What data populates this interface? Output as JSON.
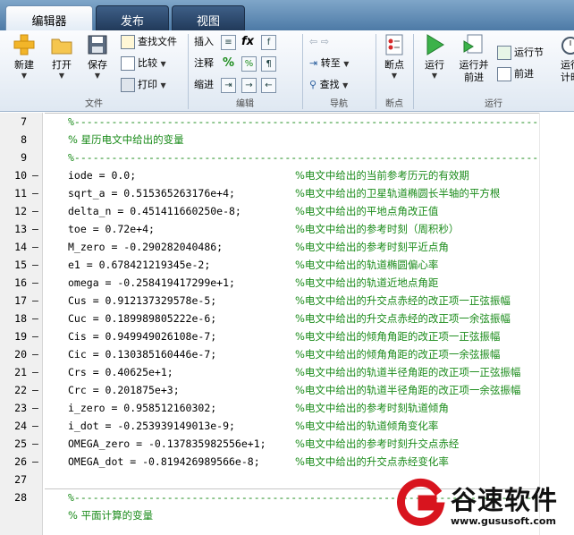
{
  "tabs": [
    {
      "label": "编辑器"
    },
    {
      "label": "发布"
    },
    {
      "label": "视图"
    }
  ],
  "ribbon": {
    "file": {
      "new_label": "新建",
      "open_label": "打开",
      "save_label": "保存",
      "find_files_label": "查找文件",
      "compare_label": "比较",
      "print_label": "打印",
      "group_label": "文件"
    },
    "edit": {
      "insert_label": "插入",
      "comment_label": "注释",
      "indent_label": "缩进",
      "fx_label": "fx",
      "percent_label": "%",
      "group_label": "编辑"
    },
    "navigate": {
      "goto_label": "转至",
      "find_label": "查找",
      "group_label": "导航"
    },
    "breakpoints": {
      "breakpoint_label": "断点",
      "group_label": "断点"
    },
    "run": {
      "run_label": "运行",
      "run_advance_label_1": "运行并",
      "run_advance_label_2": "前进",
      "run_section_label": "运行节",
      "advance_label": "前进",
      "run_time_label_1": "运行",
      "run_time_label_2": "计时",
      "group_label": "运行"
    }
  },
  "editor": {
    "lines": [
      {
        "num": "7",
        "dash": "",
        "type": "full",
        "text": "%---------------------------------------------------------------------------"
      },
      {
        "num": "8",
        "dash": "",
        "type": "fullcjk",
        "text": "% 星历电文中给出的变量"
      },
      {
        "num": "9",
        "dash": "",
        "type": "full",
        "text": "%---------------------------------------------------------------------------"
      },
      {
        "num": "10",
        "dash": "–",
        "type": "code",
        "code": "iode = 0.0;",
        "comment": "%电文中给出的当前参考历元的有效期"
      },
      {
        "num": "11",
        "dash": "–",
        "type": "code",
        "code": "sqrt_a = 0.515365263176e+4;",
        "comment": "%电文中给出的卫星轨道椭圆长半轴的平方根"
      },
      {
        "num": "12",
        "dash": "–",
        "type": "code",
        "code": "delta_n = 0.451411660250e-8;",
        "comment": "%电文中给出的平地点角改正值"
      },
      {
        "num": "13",
        "dash": "–",
        "type": "code",
        "code": "toe = 0.72e+4;",
        "comment": "%电文中给出的参考时刻（周积秒）"
      },
      {
        "num": "14",
        "dash": "–",
        "type": "code",
        "code": "M_zero = -0.290282040486;",
        "comment": "%电文中给出的参考时刻平近点角"
      },
      {
        "num": "15",
        "dash": "–",
        "type": "code",
        "code": "e1 = 0.678421219345e-2;",
        "comment": "%电文中给出的轨道椭圆偏心率"
      },
      {
        "num": "16",
        "dash": "–",
        "type": "code",
        "code": "omega = -0.258419417299e+1;",
        "comment": "%电文中给出的轨道近地点角距"
      },
      {
        "num": "17",
        "dash": "–",
        "type": "code",
        "code": "Cus = 0.912137329578e-5;",
        "comment": "%电文中给出的升交点赤经的改正项一正弦振幅"
      },
      {
        "num": "18",
        "dash": "–",
        "type": "code",
        "code": "Cuc = 0.189989805222e-6;",
        "comment": "%电文中给出的升交点赤经的改正项一余弦振幅"
      },
      {
        "num": "19",
        "dash": "–",
        "type": "code",
        "code": "Cis = 0.949949026108e-7;",
        "comment": "%电文中给出的倾角角距的改正项一正弦振幅"
      },
      {
        "num": "20",
        "dash": "–",
        "type": "code",
        "code": "Cic = 0.130385160446e-7;",
        "comment": "%电文中给出的倾角角距的改正项一余弦振幅"
      },
      {
        "num": "21",
        "dash": "–",
        "type": "code",
        "code": "Crs = 0.40625e+1;",
        "comment": "%电文中给出的轨道半径角距的改正项一正弦振幅"
      },
      {
        "num": "22",
        "dash": "–",
        "type": "code",
        "code": "Crc = 0.201875e+3;",
        "comment": "%电文中给出的轨道半径角距的改正项一余弦振幅"
      },
      {
        "num": "23",
        "dash": "–",
        "type": "code",
        "code": "i_zero = 0.958512160302;",
        "comment": "%电文中给出的参考时刻轨道倾角"
      },
      {
        "num": "24",
        "dash": "–",
        "type": "code",
        "code": "i_dot = -0.253939149013e-9;",
        "comment": "%电文中给出的轨道倾角变化率"
      },
      {
        "num": "25",
        "dash": "–",
        "type": "code",
        "code": "OMEGA_zero = -0.137835982556e+1;",
        "comment": "%电文中给出的参考时刻升交点赤经"
      },
      {
        "num": "26",
        "dash": "–",
        "type": "code",
        "code": "OMEGA_dot = -0.819426989566e-8;",
        "comment": "%电文中给出的升交点赤经变化率"
      },
      {
        "num": "27",
        "dash": "",
        "type": "blank"
      },
      {
        "num": "28",
        "dash": "",
        "type": "full",
        "text": "%---------------------------------------------------------------------------"
      },
      {
        "num": "",
        "dash": "",
        "type": "fullcjk",
        "text": "% 平面计算的变量"
      }
    ]
  },
  "watermark": {
    "name": "谷速软件",
    "url": "www.gususoft.com"
  },
  "colors": {
    "comment": "#1a8b1a",
    "tabstrip": "#4d7aa6",
    "watermark_red": "#d8141e"
  }
}
